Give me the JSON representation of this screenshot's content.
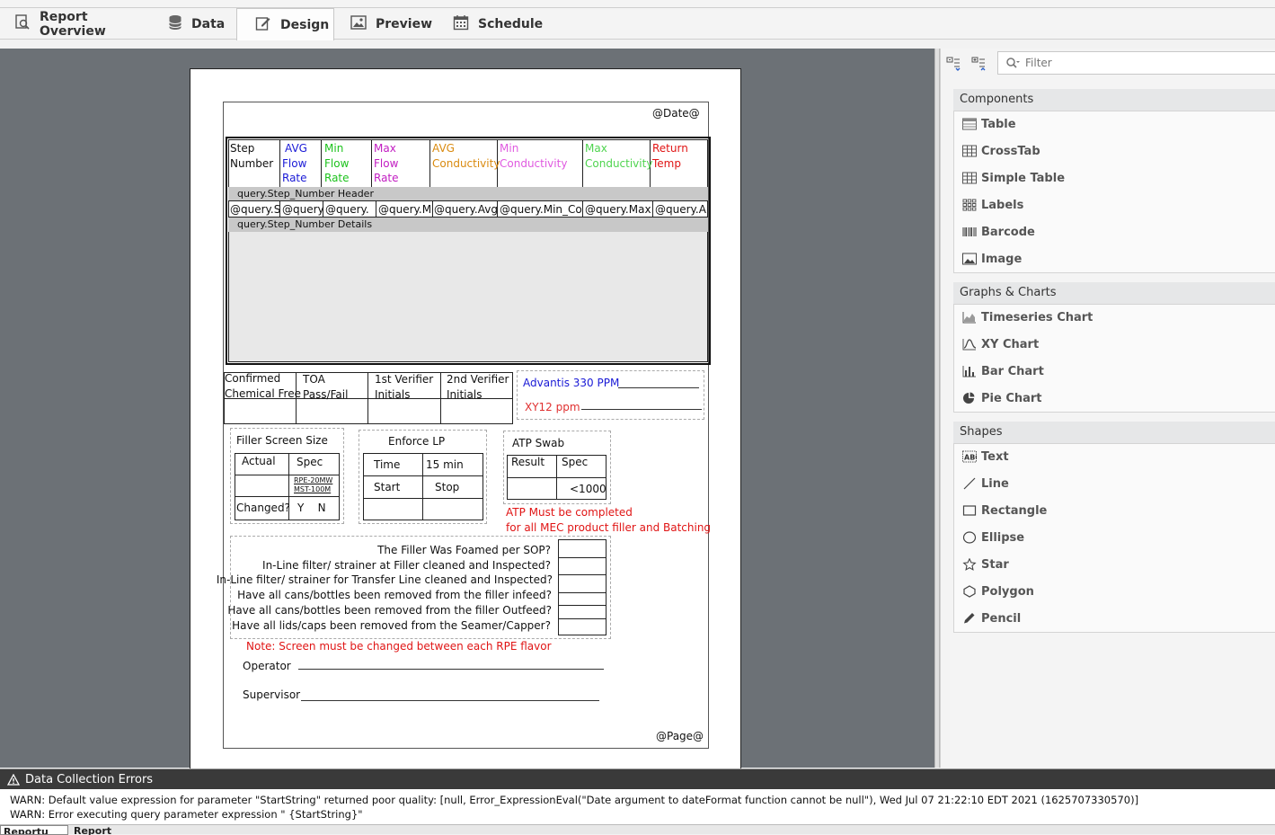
{
  "tabs": [
    {
      "label": "Report Overview",
      "icon": "report-overview-icon"
    },
    {
      "label": "Data",
      "icon": "database-icon"
    },
    {
      "label": "Design",
      "icon": "design-icon"
    },
    {
      "label": "Preview",
      "icon": "preview-icon"
    },
    {
      "label": "Schedule",
      "icon": "calendar-icon"
    }
  ],
  "active_tab": "Design",
  "filter": {
    "placeholder": "Filter"
  },
  "palette": {
    "components": {
      "title": "Components",
      "items": [
        "Table",
        "CrossTab",
        "Simple Table",
        "Labels",
        "Barcode",
        "Image"
      ]
    },
    "graphs": {
      "title": "Graphs & Charts",
      "items": [
        "Timeseries Chart",
        "XY Chart",
        "Bar Chart",
        "Pie Chart"
      ]
    },
    "shapes": {
      "title": "Shapes",
      "items": [
        "Text",
        "Line",
        "Rectangle",
        "Ellipse",
        "Star",
        "Polygon",
        "Pencil"
      ]
    }
  },
  "report": {
    "date": "@Date@",
    "page": "@Page@",
    "table_headers": [
      {
        "l1": "Step",
        "l2": "Number",
        "l3": "",
        "color": "#111111"
      },
      {
        "l1": "AVG",
        "l2": "Flow",
        "l3": "Rate",
        "color": "#1a1ad6"
      },
      {
        "l1": "Min",
        "l2": "Flow",
        "l3": "Rate",
        "color": "#1dc21d"
      },
      {
        "l1": "Max",
        "l2": "Flow",
        "l3": "Rate",
        "color": "#c21dc2"
      },
      {
        "l1": "AVG",
        "l2": "Conductivity",
        "l3": "",
        "color": "#d98a0f"
      },
      {
        "l1": "Min",
        "l2": "Conductivity",
        "l3": "",
        "color": "#e05ae0"
      },
      {
        "l1": "Max",
        "l2": "Conductivity",
        "l3": "",
        "color": "#4fd44f"
      },
      {
        "l1": "Return",
        "l2": "Temp",
        "l3": "",
        "color": "#e01515"
      }
    ],
    "group_header": "query.Step_Number Header",
    "detail_cells": [
      "@query.S",
      "@query",
      "@query.",
      "@query.M",
      "@query.Avg",
      "@query.Min_Co",
      "@query.Max",
      "@query.A"
    ],
    "details_label": "query.Step_Number Details",
    "verify_headers": [
      {
        "l1": "Confirmed",
        "l2": "Chemical Free"
      },
      {
        "l1": "TOA",
        "l2": "Pass/Fail"
      },
      {
        "l1": "1st Verifier",
        "l2": "Initials"
      },
      {
        "l1": "2nd Verifier",
        "l2": "Initials"
      }
    ],
    "advantis": "Advantis 330 PPM",
    "xy12": "XY12 ppm",
    "filler_screen": {
      "title": "Filler Screen Size",
      "actual": "Actual",
      "spec": "Spec",
      "spec_l1": "RPE-20MW",
      "spec_l2": "MST-100M",
      "changed": "Changed?",
      "yn": "Y    N"
    },
    "enforce_lp": {
      "title": "Enforce LP",
      "time": "Time",
      "time_val": "15 min",
      "start": "Start",
      "stop": "Stop"
    },
    "atp_swab": {
      "title": "ATP Swab",
      "result": "Result",
      "spec": "Spec",
      "spec_val": "<1000"
    },
    "atp_note_l1": "ATP Must be completed",
    "atp_note_l2": "for all MEC product filler and Batching",
    "checklist": [
      "The Filler Was Foamed per SOP?",
      "In-Line filter/ strainer at Filler cleaned and Inspected?",
      "In-Line filter/ strainer for Transfer Line cleaned and Inspected?",
      "Have all cans/bottles been removed from the filler infeed?",
      "Have all cans/bottles been removed from the filler Outfeed?",
      "Have all lids/caps been removed from the Seamer/Capper?"
    ],
    "screen_note": "Note: Screen must be changed between each RPE flavor",
    "operator": "Operator",
    "supervisor": "Supervisor"
  },
  "errors": {
    "title": "Data Collection Errors",
    "lines": [
      "WARN: Default value expression for parameter \"StartString\" returned poor quality: [null, Error_ExpressionEval(\"Date argument to dateFormat function cannot be null\"), Wed Jul 07 21:22:10 EDT 2021 (1625707330570)]",
      "WARN: Error executing query parameter expression \" {StartString}\""
    ]
  },
  "bottom_tabs": [
    "Reportu",
    "Report"
  ]
}
